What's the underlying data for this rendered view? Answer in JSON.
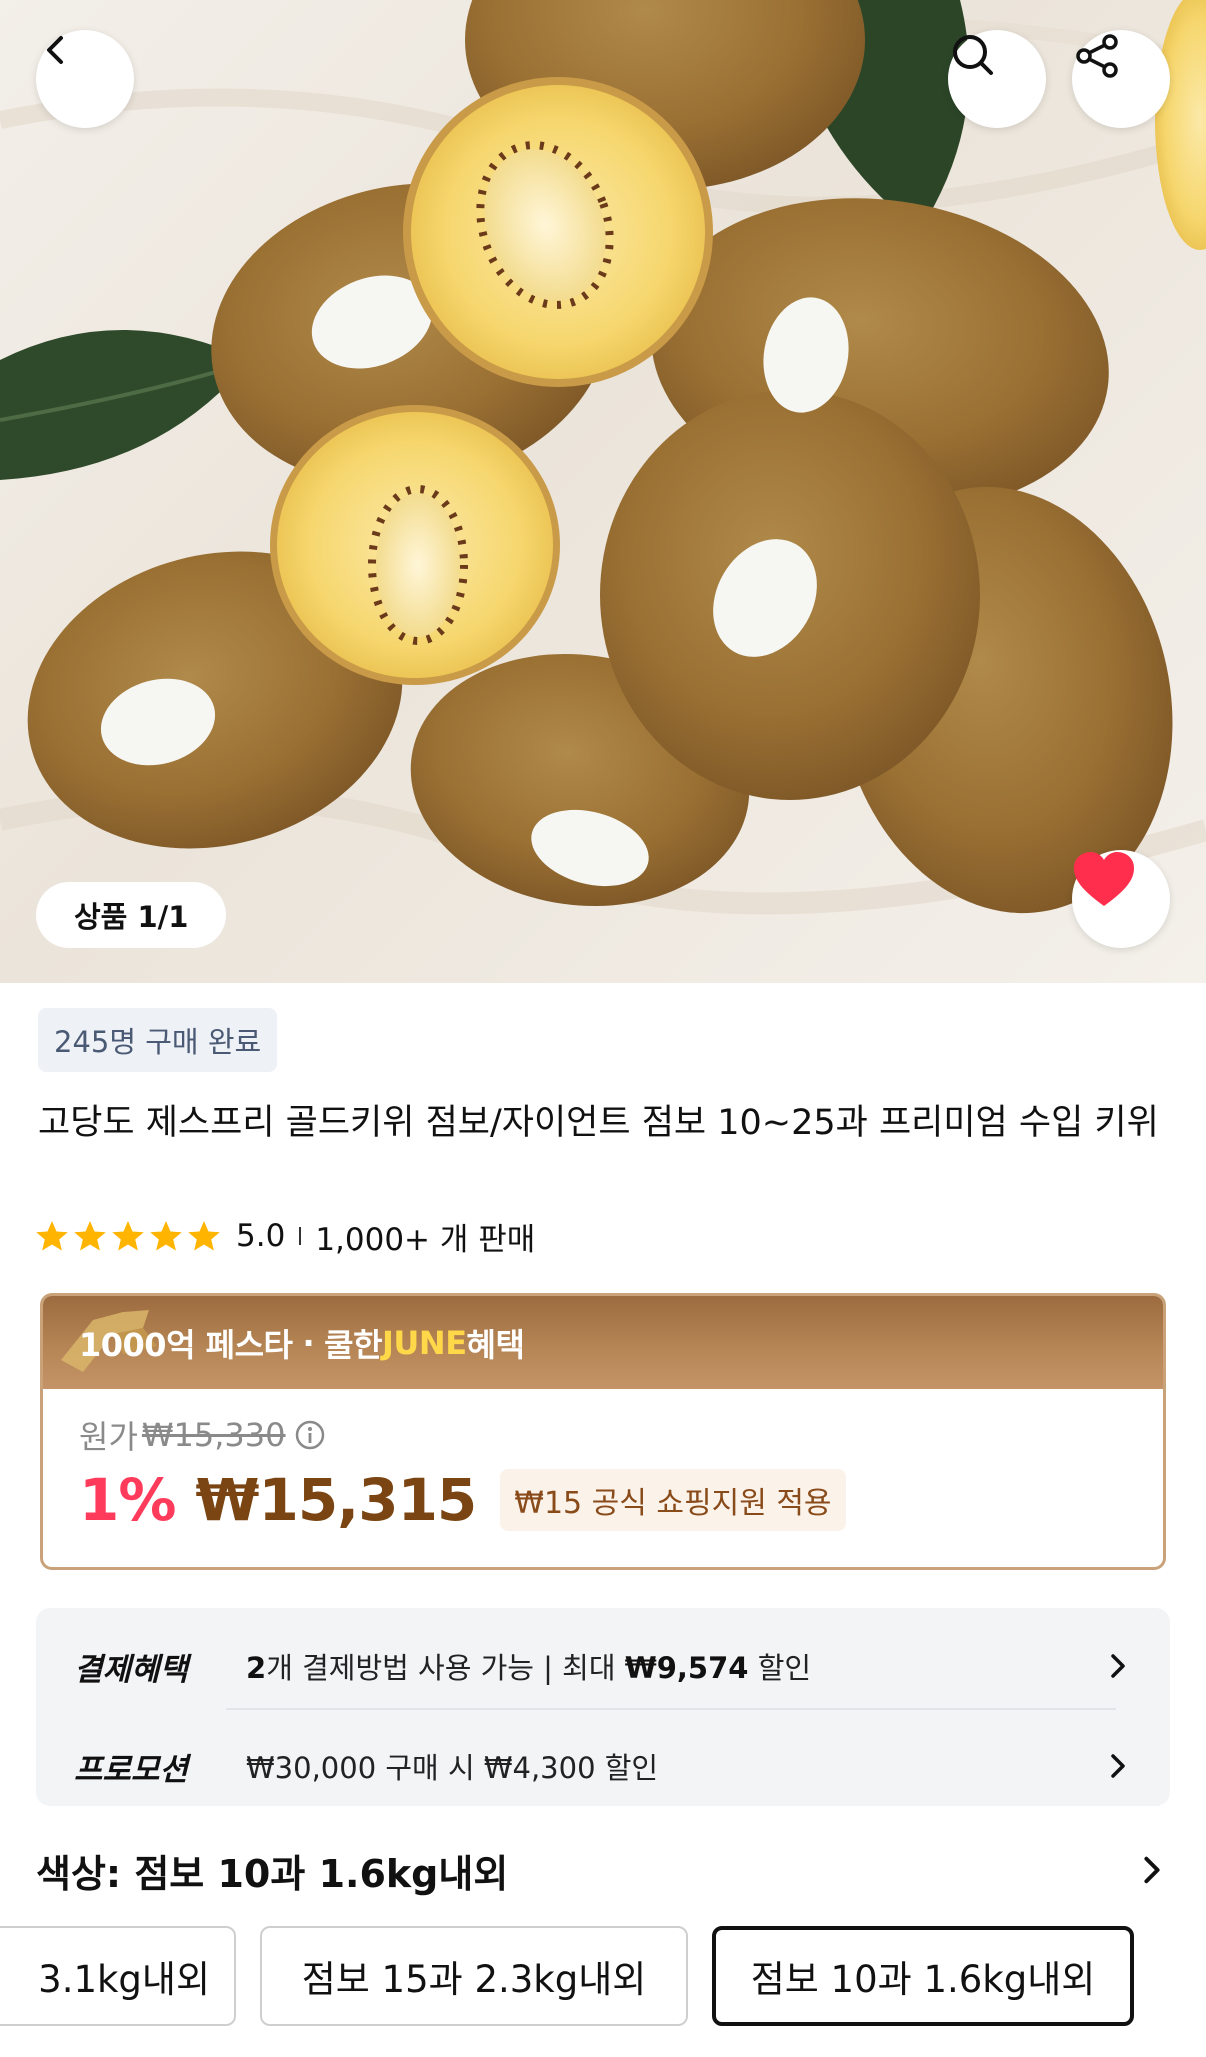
{
  "nav": {
    "back_icon": "chevron-left-icon",
    "search_icon": "search-icon",
    "share_icon": "share-icon"
  },
  "gallery": {
    "counter": "상품 1/1",
    "favorite_icon": "heart-icon",
    "favorite_color": "#ff2e4c"
  },
  "product": {
    "purchase_badge": "245명 구매 완료",
    "title": "고당도 제스프리 골드키위 점보/자이언트 점보 10~25과 프리미엄 수입 키위",
    "rating": {
      "value": "5.0",
      "stars": 5,
      "sales": "1,000+ 개 판매"
    }
  },
  "price": {
    "promo_main": "1000억 페스타",
    "promo_sep": "·",
    "promo_cool": "쿨한",
    "promo_june": "JUNE",
    "promo_benefit": "혜택",
    "original_label": "원가",
    "original_price": "₩15,330",
    "discount": "1%",
    "final_price": "₩15,315",
    "support_chip": "₩15 공식 쇼핑지원 적용",
    "discount_color": "#ff3b5c",
    "price_color": "#7a4512"
  },
  "benefits": {
    "payment_label": "결제혜택",
    "payment_count": "2",
    "payment_text": "개 결제방법 사용 가능 | 최대",
    "payment_amount": "₩9,574",
    "payment_suffix": "할인",
    "promo_label": "프로모션",
    "promo_text": "₩30,000 구매 시 ₩4,300 할인"
  },
  "options": {
    "title": "색상: 점보 10과 1.6kg내외",
    "chips": [
      "3.1kg내외",
      "점보 15과 2.3kg내외",
      "점보 10과 1.6kg내외"
    ],
    "selected_index": 2
  }
}
